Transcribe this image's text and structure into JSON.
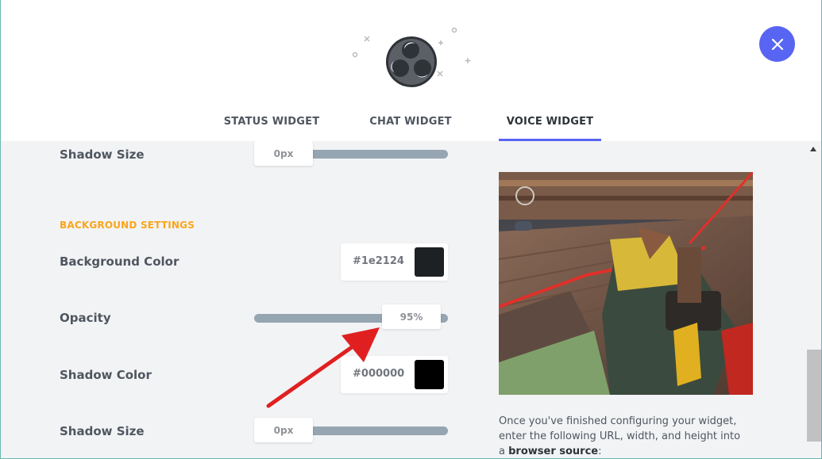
{
  "tabs": [
    {
      "label": "STATUS WIDGET",
      "active": false
    },
    {
      "label": "CHAT WIDGET",
      "active": false
    },
    {
      "label": "VOICE WIDGET",
      "active": true
    }
  ],
  "settings": {
    "top_shadow_size": {
      "label": "Shadow Size",
      "value": "0px",
      "fraction": 0.0
    },
    "background_section_title": "BACKGROUND SETTINGS",
    "background_color": {
      "label": "Background Color",
      "hex": "#1e2124"
    },
    "opacity": {
      "label": "Opacity",
      "value": "95%",
      "fraction": 0.95
    },
    "shadow_color": {
      "label": "Shadow Color",
      "hex": "#000000"
    },
    "bottom_shadow_size": {
      "label": "Shadow Size",
      "value": "0px",
      "fraction": 0.0
    }
  },
  "info": {
    "text_line1": "Once you've finished configuring your widget,",
    "text_line2": "enter the following URL, width, and height into",
    "text_line3_prefix": "a ",
    "text_line3_bold": "browser source",
    "text_line3_suffix": ":"
  },
  "icons": {
    "logo": "obs-logo-icon",
    "close": "close-icon",
    "scroll_up": "scroll-up-arrow-icon",
    "annotation": "red-arrow-annotation"
  },
  "colors": {
    "accent": "#5865f2",
    "section_title": "#faa61a",
    "slider_track": "#96a5b2",
    "annotation_arrow": "#e02020"
  }
}
